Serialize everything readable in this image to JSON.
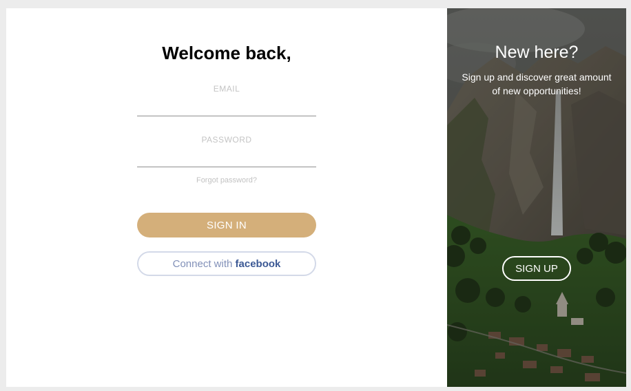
{
  "login": {
    "title": "Welcome back,",
    "email_label": "EMAIL",
    "email_value": "",
    "password_label": "PASSWORD",
    "password_value": "",
    "forgot_label": "Forgot password?",
    "signin_label": "SIGN IN",
    "facebook_prefix": "Connect with",
    "facebook_brand": "facebook"
  },
  "signup": {
    "title": "New here?",
    "text": "Sign up and discover great amount of new opportunities!",
    "button_label": "SIGN UP"
  },
  "colors": {
    "accent": "#d4af7a",
    "facebook_brand": "#3b5894",
    "facebook_border": "#d3d9e8"
  }
}
